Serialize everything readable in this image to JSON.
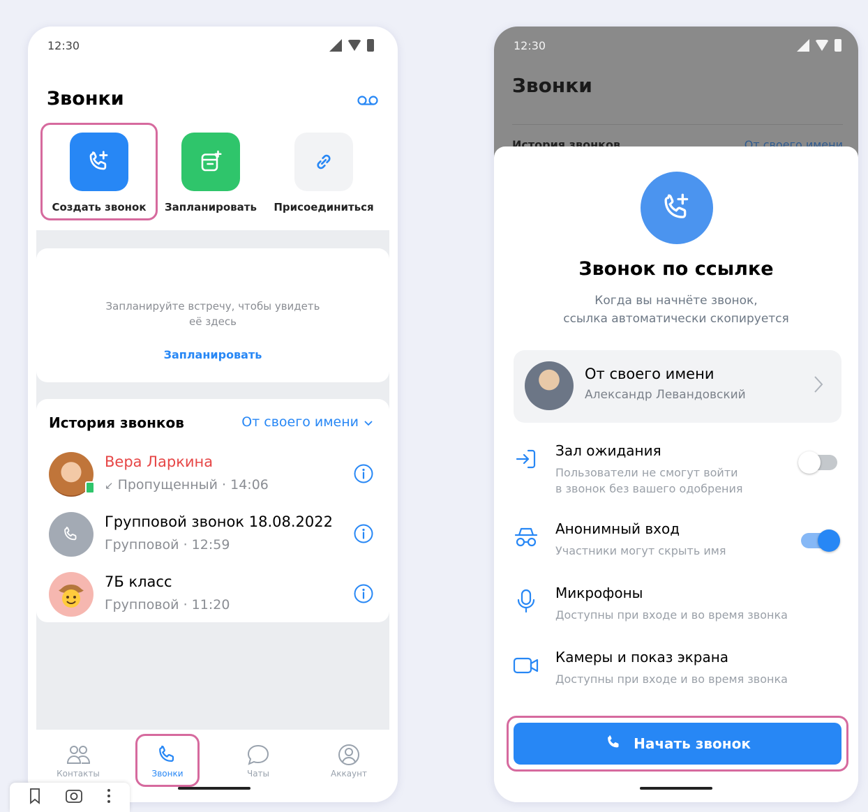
{
  "left_phone": {
    "status_time": "12:30",
    "title": "Звонки",
    "actions": [
      {
        "label": "Создать звонок",
        "icon": "phone-plus-icon",
        "color": "#2787f5"
      },
      {
        "label": "Запланировать",
        "icon": "calendar-plus-icon",
        "color": "#2fc56b"
      },
      {
        "label": "Присоединиться",
        "icon": "link-icon",
        "color": "#f2f3f5"
      }
    ],
    "plan_card": {
      "text_line1": "Запланируйте встречу, чтобы увидеть",
      "text_line2": "её здесь",
      "link": "Запланировать"
    },
    "history": {
      "title": "История звонков",
      "filter": "От своего имени",
      "calls": [
        {
          "name": "Вера Ларкина",
          "detail": "Пропущенный · 14:06",
          "missed": true,
          "avatar": "user-photo"
        },
        {
          "name": "Групповой звонок 18.08.2022",
          "detail": "Групповой · 12:59",
          "missed": false,
          "avatar": "phone-icon"
        },
        {
          "name": "7Б класс",
          "detail": "Групповой · 11:20",
          "missed": false,
          "avatar": "emoji-cowboy"
        }
      ]
    },
    "tabs": [
      {
        "label": "Контакты",
        "icon": "contacts-icon"
      },
      {
        "label": "Звонки",
        "icon": "phone-icon",
        "active": true
      },
      {
        "label": "Чаты",
        "icon": "chat-icon"
      },
      {
        "label": "Аккаунт",
        "icon": "account-icon"
      }
    ]
  },
  "right_phone": {
    "status_time": "12:30",
    "title": "Звонки",
    "peek_left": "История звонков",
    "peek_right": "От своего имени",
    "sheet": {
      "title": "Звонок по ссылке",
      "desc_line1": "Когда вы начнёте звонок,",
      "desc_line2": "ссылка автоматически скопируется",
      "from": {
        "title": "От своего имени",
        "name": "Александр Левандовский"
      },
      "options": [
        {
          "title": "Зал ожидания",
          "sub_line1": "Пользователи не смогут войти",
          "sub_line2": "в звонок без вашего одобрения",
          "icon": "enter-icon",
          "toggle": false
        },
        {
          "title": "Анонимный вход",
          "sub_line1": "Участники могут скрыть имя",
          "sub_line2": "",
          "icon": "incognito-icon",
          "toggle": true
        },
        {
          "title": "Микрофоны",
          "sub_line1": "Доступны при входе и во время звонка",
          "sub_line2": "",
          "icon": "microphone-icon"
        },
        {
          "title": "Камеры и показ экрана",
          "sub_line1": "Доступны при входе и во время звонка",
          "sub_line2": "",
          "icon": "camera-icon"
        }
      ],
      "start_button": "Начать звонок"
    }
  },
  "colors": {
    "accent": "#2787f5",
    "green": "#2fc56b",
    "highlight": "#d66a9e",
    "missed": "#e64646"
  }
}
